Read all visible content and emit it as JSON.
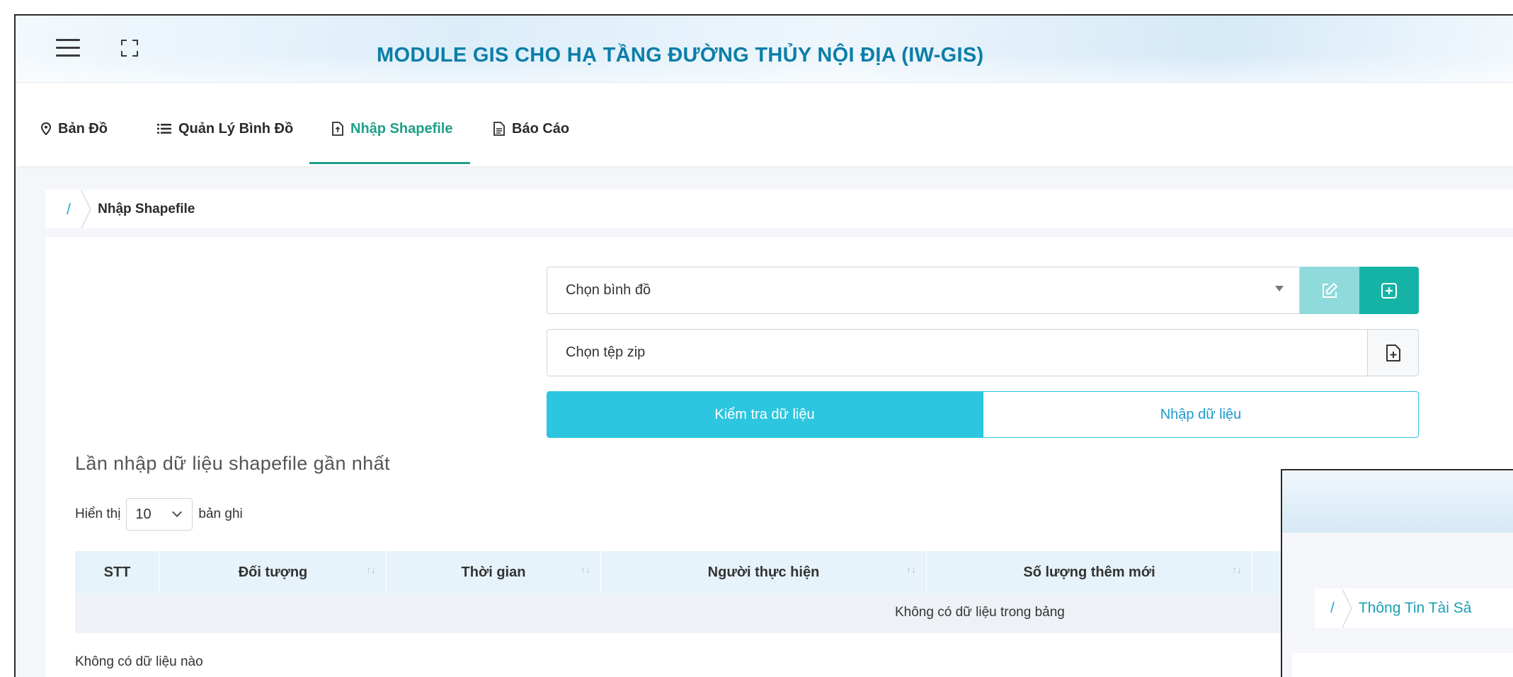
{
  "header": {
    "title": "MODULE GIS CHO HẠ TẦNG ĐƯỜNG THỦY NỘI ĐỊA (IW-GIS)",
    "menu_icon": "hamburger-icon",
    "fullscreen_icon": "fullscreen-icon"
  },
  "nav": {
    "items": [
      {
        "label": "Bản Đồ",
        "icon": "map-pin-icon"
      },
      {
        "label": "Quản Lý Bình Đồ",
        "icon": "list-icon"
      },
      {
        "label": "Nhập Shapefile",
        "icon": "file-upload-icon",
        "active": true
      },
      {
        "label": "Báo Cáo",
        "icon": "report-icon"
      }
    ]
  },
  "breadcrumb": {
    "separator": "/",
    "current": "Nhập Shapefile"
  },
  "form": {
    "map_select_placeholder": "Chọn bình đồ",
    "zip_placeholder": "Chọn tệp zip",
    "check_button": "Kiểm tra dữ liệu",
    "import_button": "Nhập dữ liệu"
  },
  "history": {
    "title": "Lần nhập dữ liệu shapefile gần nhất",
    "show_prefix": "Hiển thị",
    "page_size": "10",
    "show_suffix": "bản ghi",
    "columns": [
      "STT",
      "Đối tượng",
      "Thời gian",
      "Người thực hiện",
      "Số lượng thêm mới"
    ],
    "empty_table": "Không có dữ liệu trong bảng",
    "no_records": "Không có dữ liệu nào"
  },
  "overlay": {
    "separator": "/",
    "crumb": "Thông Tin Tài Sả"
  },
  "colors": {
    "accent_teal": "#1e9f8a",
    "title_blue": "#0b7ea8",
    "check_button_bg": "#2cc6e0",
    "add_button_bg": "#14b3a5",
    "edit_button_bg": "#8fdadb"
  }
}
